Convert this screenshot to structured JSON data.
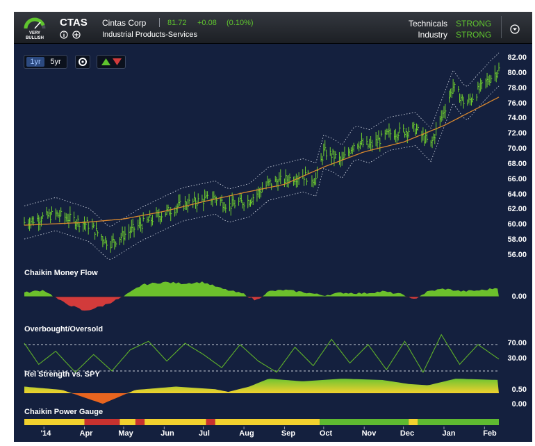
{
  "header": {
    "rating_label": "VERY BULLISH",
    "ticker": "CTAS",
    "company_name": "Cintas Corp",
    "price": "81.72",
    "change": "+0.08",
    "change_pct": "(0.10%)",
    "industry": "Industrial Products-Services",
    "technicals_label": "Technicals",
    "technicals_value": "STRONG",
    "industry_label": "Industry",
    "industry_value": "STRONG",
    "colors": {
      "positive": "#5fc42e",
      "text": "#ffffff",
      "header_bg": "#26292f"
    },
    "icons": [
      "gauge-icon",
      "info-icon",
      "add-icon",
      "menu-dropdown-icon"
    ]
  },
  "toolbar": {
    "range_1yr": "1yr",
    "range_5yr": "5yr",
    "selected_range": "1yr",
    "icons": [
      "settings-icon",
      "up-down-arrows-icon"
    ]
  },
  "chart_data": [
    {
      "panel": "price",
      "type": "ohlc",
      "ylim": [
        55,
        83
      ],
      "yticks": [
        "82.00",
        "80.00",
        "78.00",
        "76.00",
        "74.00",
        "72.00",
        "70.00",
        "68.00",
        "66.00",
        "64.00",
        "62.00",
        "60.00",
        "58.00",
        "56.00"
      ],
      "x_labels": [
        "'14",
        "Apr",
        "May",
        "Jun",
        "Jul",
        "Aug",
        "Sep",
        "Oct",
        "Nov",
        "Dec",
        "Jan",
        "Feb"
      ],
      "x_label_dates": [
        "2014-03-01",
        "2014-04-01",
        "2014-05-01",
        "2014-06-01",
        "2014-07-01",
        "2014-08-01",
        "2014-09-01",
        "2014-10-01",
        "2014-11-01",
        "2014-12-01",
        "2015-01-01",
        "2015-02-01"
      ],
      "series_anchor_dates": [
        "2014-02-14",
        "2014-03-10",
        "2014-04-05",
        "2014-04-20",
        "2014-05-15",
        "2014-06-15",
        "2014-07-10",
        "2014-07-20",
        "2014-08-05",
        "2014-08-20",
        "2014-09-15",
        "2014-09-25",
        "2014-10-01",
        "2014-10-08",
        "2014-10-15",
        "2014-10-25",
        "2014-11-05",
        "2014-11-20",
        "2014-12-10",
        "2014-12-22",
        "2014-12-28",
        "2015-01-08",
        "2015-01-18",
        "2015-01-28",
        "2015-02-06",
        "2015-02-12"
      ],
      "close_anchors": [
        59.6,
        60.8,
        59.2,
        56.5,
        59.4,
        62.2,
        63.2,
        62.0,
        62.8,
        65.2,
        66.4,
        65.8,
        69.8,
        69.3,
        68.4,
        71.2,
        70.6,
        72.4,
        73.1,
        70.8,
        73.8,
        79.2,
        76.6,
        78.8,
        80.6,
        81.7
      ],
      "ma_anchor_dates": [
        "2014-02-14",
        "2014-04-01",
        "2014-05-01",
        "2014-06-01",
        "2014-07-01",
        "2014-08-01",
        "2014-09-01",
        "2014-10-01",
        "2014-11-01",
        "2014-12-01",
        "2015-01-01",
        "2015-02-12"
      ],
      "ma_values": [
        59.2,
        59.6,
        60.1,
        61.2,
        62.6,
        63.9,
        65.1,
        67.6,
        69.8,
        71.2,
        73.6,
        77.7
      ],
      "colors": {
        "bars": "#6fcf2f",
        "moving_average": "#d9882e",
        "bands": "#c9cfdb"
      }
    },
    {
      "panel": "Chaikin Money Flow",
      "type": "area",
      "title": "Chaikin Money Flow",
      "zero_label": "0.00",
      "anchor_dates": [
        "2014-02-14",
        "2014-03-01",
        "2014-03-15",
        "2014-04-01",
        "2014-04-15",
        "2014-05-01",
        "2014-05-15",
        "2014-06-01",
        "2014-06-15",
        "2014-07-01",
        "2014-07-15",
        "2014-08-01",
        "2014-08-10",
        "2014-08-20",
        "2014-09-01",
        "2014-09-15",
        "2014-10-01",
        "2014-10-15",
        "2014-11-01",
        "2014-11-15",
        "2014-12-01",
        "2014-12-08",
        "2014-12-20",
        "2015-01-01",
        "2015-01-15",
        "2015-02-01",
        "2015-02-12"
      ],
      "values": [
        0.06,
        0.1,
        -0.08,
        -0.22,
        -0.14,
        0.0,
        0.18,
        0.22,
        0.2,
        0.22,
        0.12,
        0.04,
        -0.06,
        0.08,
        0.1,
        0.07,
        0.02,
        0.06,
        0.05,
        0.08,
        0.03,
        -0.05,
        0.08,
        0.12,
        0.08,
        0.1,
        0.14
      ],
      "colors": {
        "positive": "#6cc02c",
        "negative": "#d23b3b"
      }
    },
    {
      "panel": "Overbought/Oversold",
      "type": "line",
      "title": "Overbought/Oversold",
      "yticks": [
        "70.00",
        "30.00"
      ],
      "levels": [
        70,
        30
      ],
      "anchor_dates": [
        "2014-02-14",
        "2014-02-25",
        "2014-03-10",
        "2014-03-25",
        "2014-04-08",
        "2014-04-22",
        "2014-05-06",
        "2014-05-20",
        "2014-06-03",
        "2014-06-17",
        "2014-07-01",
        "2014-07-15",
        "2014-07-29",
        "2014-08-12",
        "2014-08-26",
        "2014-09-09",
        "2014-09-23",
        "2014-10-07",
        "2014-10-21",
        "2014-11-04",
        "2014-11-18",
        "2014-12-02",
        "2014-12-16",
        "2014-12-30",
        "2015-01-13",
        "2015-01-27",
        "2015-02-12"
      ],
      "values": [
        72,
        40,
        60,
        28,
        55,
        30,
        62,
        75,
        45,
        72,
        55,
        35,
        70,
        45,
        28,
        66,
        38,
        78,
        42,
        70,
        32,
        75,
        28,
        85,
        40,
        70,
        48
      ],
      "colors": {
        "line": "#5fb22a",
        "levels": "#c8ced8"
      }
    },
    {
      "panel": "Rel Strength vs. SPY",
      "type": "area",
      "title": "Rel Strength vs. SPY",
      "yticks": [
        "0.50",
        "0.00"
      ],
      "anchor_dates": [
        "2014-02-14",
        "2014-03-15",
        "2014-04-15",
        "2014-05-10",
        "2014-06-10",
        "2014-07-10",
        "2014-07-20",
        "2014-08-05",
        "2014-08-20",
        "2014-09-15",
        "2014-10-15",
        "2014-11-15",
        "2014-12-05",
        "2014-12-20",
        "2015-01-10",
        "2015-02-12"
      ],
      "values": [
        0.1,
        0.05,
        -0.16,
        0.05,
        0.1,
        0.06,
        0.02,
        0.1,
        0.22,
        0.18,
        0.22,
        0.2,
        0.14,
        0.12,
        0.22,
        0.2
      ],
      "colors": {
        "positive_top": "#6fc431",
        "positive_base": "#f2d12e",
        "negative": "#e8651f"
      }
    },
    {
      "panel": "Chaikin Power Gauge",
      "type": "band",
      "title": "Chaikin Power Gauge",
      "segments": [
        {
          "start": "2014-02-14",
          "end": "2014-04-01",
          "rating": "neutral"
        },
        {
          "start": "2014-04-01",
          "end": "2014-04-28",
          "rating": "bearish"
        },
        {
          "start": "2014-04-28",
          "end": "2014-05-10",
          "rating": "neutral"
        },
        {
          "start": "2014-05-10",
          "end": "2014-05-17",
          "rating": "bearish"
        },
        {
          "start": "2014-05-17",
          "end": "2014-07-03",
          "rating": "neutral"
        },
        {
          "start": "2014-07-03",
          "end": "2014-07-10",
          "rating": "bearish"
        },
        {
          "start": "2014-07-10",
          "end": "2014-09-28",
          "rating": "neutral"
        },
        {
          "start": "2014-09-28",
          "end": "2014-12-05",
          "rating": "bullish"
        },
        {
          "start": "2014-12-05",
          "end": "2014-12-12",
          "rating": "neutral"
        },
        {
          "start": "2014-12-12",
          "end": "2015-02-12",
          "rating": "bullish"
        }
      ],
      "colors": {
        "bullish": "#5fba31",
        "neutral": "#f2d12e",
        "bearish": "#c8322f"
      }
    }
  ]
}
